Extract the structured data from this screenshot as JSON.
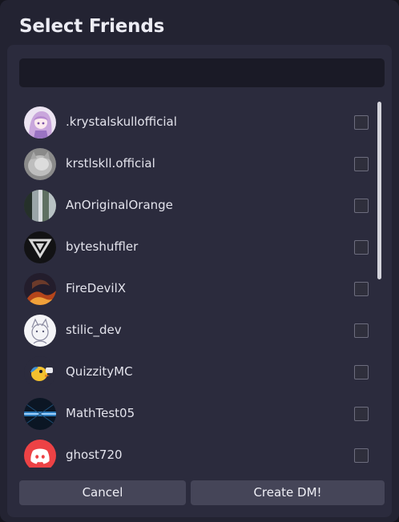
{
  "dialog": {
    "title": "Select Friends",
    "search": {
      "value": "",
      "placeholder": ""
    }
  },
  "friends": [
    {
      "username": ".krystalskullofficial",
      "avatar": "anime-girl-avatar",
      "checked": false
    },
    {
      "username": "krstlskll.official",
      "avatar": "grey-cat-avatar",
      "checked": false
    },
    {
      "username": "AnOriginalOrange",
      "avatar": "waterfall-avatar",
      "checked": false
    },
    {
      "username": "byteshuffler",
      "avatar": "triangle-logo-avatar",
      "checked": false
    },
    {
      "username": "FireDevilX",
      "avatar": "fire-dragon-avatar",
      "checked": false
    },
    {
      "username": "stilic_dev",
      "avatar": "sketch-character-avatar",
      "checked": false
    },
    {
      "username": "QuizzityMC",
      "avatar": "yellow-bird-avatar",
      "checked": false
    },
    {
      "username": "MathTest05",
      "avatar": "blue-tunnel-avatar",
      "checked": false
    },
    {
      "username": "ghost720",
      "avatar": "discord-logo-avatar",
      "checked": false
    }
  ],
  "actions": {
    "cancel_label": "Cancel",
    "create_label": "Create DM!"
  },
  "colors": {
    "modal_bg": "#232332",
    "panel_bg": "#2b2b3d",
    "input_bg": "#1a1a26",
    "button_bg": "#454558",
    "discord_red": "#ed4245"
  }
}
